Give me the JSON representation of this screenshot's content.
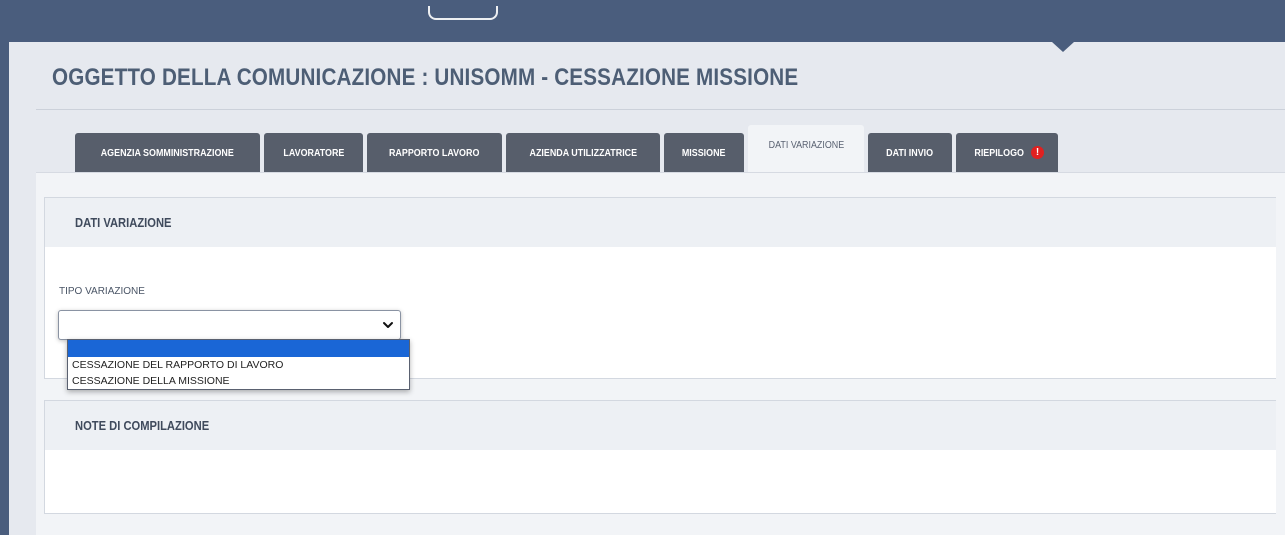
{
  "page": {
    "title": "OGGETTO DELLA COMUNICAZIONE : UNISOMM - CESSAZIONE MISSIONE"
  },
  "tabs": [
    {
      "label": "AGENZIA SOMMINISTRAZIONE",
      "active": false
    },
    {
      "label": "LAVORATORE",
      "active": false
    },
    {
      "label": "RAPPORTO LAVORO",
      "active": false
    },
    {
      "label": "AZIENDA UTILIZZATRICE",
      "active": false
    },
    {
      "label": "MISSIONE",
      "active": false
    },
    {
      "label": "DATI VARIAZIONE",
      "active": true
    },
    {
      "label": "DATI INVIO",
      "active": false
    },
    {
      "label": "RIEPILOGO",
      "active": false,
      "warning_icon": "exclamation-icon"
    }
  ],
  "sections": {
    "dati_variazione": {
      "title": "DATI VARIAZIONE",
      "tipo_variazione": {
        "label": "TIPO VARIAZIONE",
        "value": "",
        "options": [
          "",
          "CESSAZIONE DEL RAPPORTO DI LAVORO",
          "CESSAZIONE DELLA MISSIONE"
        ]
      }
    },
    "note": {
      "title": "NOTE DI COMPILAZIONE"
    }
  },
  "colors": {
    "topbar": "#4a5d7d",
    "tab": "#575e6b",
    "title": "#4d5e75",
    "dropdown_selected": "#1a66d6",
    "warning": "#e02020"
  }
}
